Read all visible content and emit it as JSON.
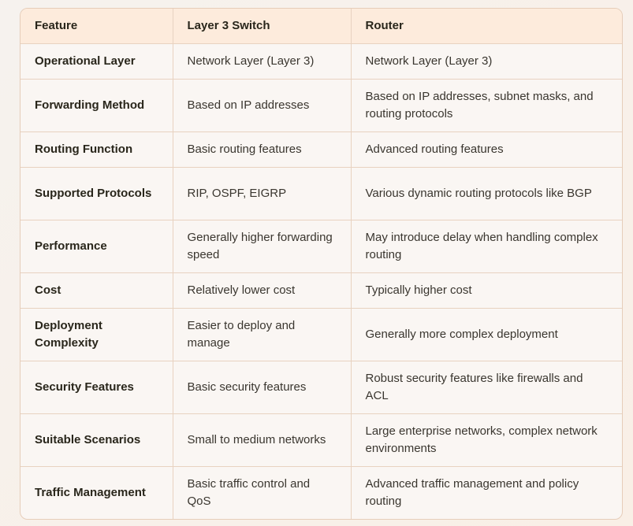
{
  "table": {
    "headers": [
      "Feature",
      "Layer 3 Switch",
      "Router"
    ],
    "rows": [
      {
        "feature": "Operational Layer",
        "switch": "Network Layer (Layer 3)",
        "router": "Network Layer (Layer 3)"
      },
      {
        "feature": "Forwarding Method",
        "switch": "Based on IP addresses",
        "router": "Based on IP addresses, subnet masks, and routing protocols"
      },
      {
        "feature": "Routing Function",
        "switch": "Basic routing features",
        "router": "Advanced routing features"
      },
      {
        "feature": "Supported Protocols",
        "switch": "RIP, OSPF, EIGRP",
        "router": "Various dynamic routing protocols like BGP"
      },
      {
        "feature": "Performance",
        "switch": "Generally higher forwarding speed",
        "router": "May introduce delay when handling complex routing"
      },
      {
        "feature": "Cost",
        "switch": "Relatively lower cost",
        "router": "Typically higher cost"
      },
      {
        "feature": "Deployment Complexity",
        "switch": "Easier to deploy and manage",
        "router": "Generally more complex deployment"
      },
      {
        "feature": "Security Features",
        "switch": "Basic security features",
        "router": "Robust security features like firewalls and ACL"
      },
      {
        "feature": "Suitable Scenarios",
        "switch": "Small to medium networks",
        "router": "Large enterprise networks, complex network environments"
      },
      {
        "feature": "Traffic Management",
        "switch": "Basic traffic control and QoS",
        "router": "Advanced traffic management and policy routing"
      }
    ]
  },
  "colors": {
    "header_bg": "#fdebdc",
    "border": "#e8d2c0",
    "body_bg": "#faf6f3",
    "text": "#29261b"
  }
}
